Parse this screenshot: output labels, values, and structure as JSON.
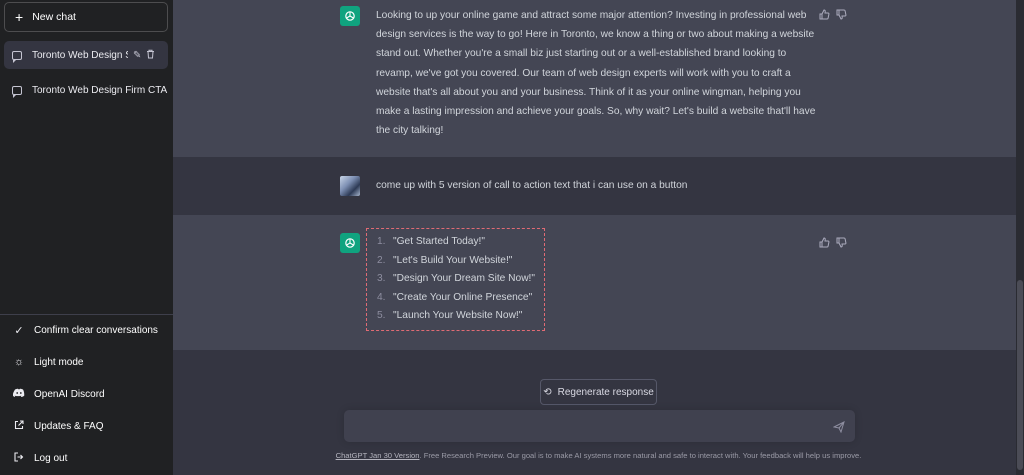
{
  "sidebar": {
    "new_chat": "New chat",
    "conversations": [
      {
        "title": "Toronto Web Design SI"
      },
      {
        "title": "Toronto Web Design Firm CTA"
      }
    ],
    "menu": [
      {
        "label": "Confirm clear conversations",
        "icon": "check-icon"
      },
      {
        "label": "Light mode",
        "icon": "sun-icon"
      },
      {
        "label": "OpenAI Discord",
        "icon": "discord-icon"
      },
      {
        "label": "Updates & FAQ",
        "icon": "external-link-icon"
      },
      {
        "label": "Log out",
        "icon": "logout-icon"
      }
    ]
  },
  "messages": [
    {
      "role": "assistant",
      "text": "Looking to up your online game and attract some major attention? Investing in professional web design services is the way to go! Here in Toronto, we know a thing or two about making a website stand out. Whether you're a small biz just starting out or a well-established brand looking to revamp, we've got you covered. Our team of web design experts will work with you to craft a website that's all about you and your business. Think of it as your online wingman, helping you make a lasting impression and achieve your goals. So, why wait? Let's build a website that'll have the city talking!"
    },
    {
      "role": "user",
      "text": "come up with 5 version of call to action text that i can use on a button"
    },
    {
      "role": "assistant",
      "items": [
        {
          "num": "1.",
          "text": "\"Get Started Today!\""
        },
        {
          "num": "2.",
          "text": "\"Let's Build Your Website!\""
        },
        {
          "num": "3.",
          "text": "\"Design Your Dream Site Now!\""
        },
        {
          "num": "4.",
          "text": "\"Create Your Online Presence\""
        },
        {
          "num": "5.",
          "text": "\"Launch Your Website Now!\""
        }
      ]
    }
  ],
  "regenerate_label": "Regenerate response",
  "input": {
    "placeholder": ""
  },
  "footer": {
    "version_link": "ChatGPT Jan 30 Version",
    "text": ". Free Research Preview. Our goal is to make AI systems more natural and safe to interact with. Your feedback will help us improve."
  },
  "colors": {
    "accent": "#10a37f",
    "sidebar": "#202123",
    "main": "#343541",
    "assistant_row": "#444654",
    "highlight_border": "#e06b74"
  }
}
